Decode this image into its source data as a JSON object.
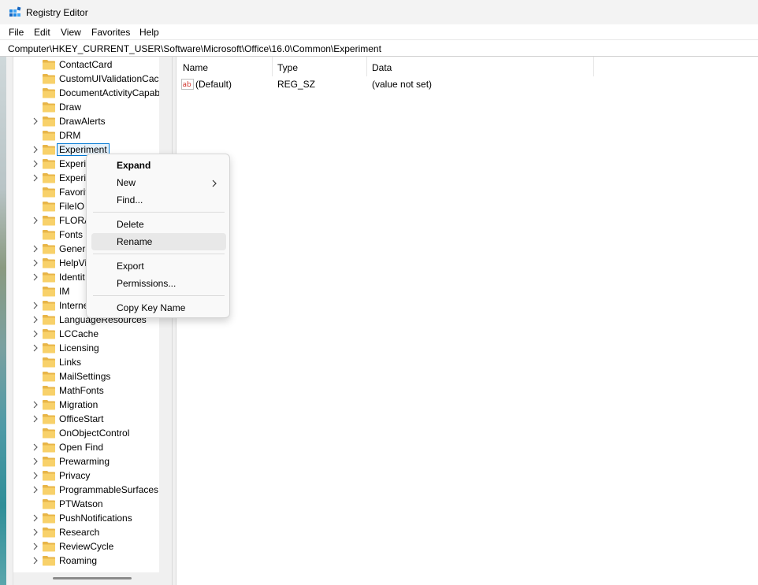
{
  "window": {
    "title": "Registry Editor",
    "app_icon": "registry-editor-icon"
  },
  "menu": [
    "File",
    "Edit",
    "View",
    "Favorites",
    "Help"
  ],
  "address": "Computer\\HKEY_CURRENT_USER\\Software\\Microsoft\\Office\\16.0\\Common\\Experiment",
  "tree": {
    "selected": "Experiment",
    "items": [
      {
        "label": "ContactCard",
        "has_children": false
      },
      {
        "label": "CustomUIValidationCac",
        "has_children": false
      },
      {
        "label": "DocumentActivityCapab",
        "has_children": false
      },
      {
        "label": "Draw",
        "has_children": false
      },
      {
        "label": "DrawAlerts",
        "has_children": true
      },
      {
        "label": "DRM",
        "has_children": false
      },
      {
        "label": "Experiment",
        "has_children": true
      },
      {
        "label": "Experin",
        "has_children": true
      },
      {
        "label": "Experin",
        "has_children": true
      },
      {
        "label": "Favorit",
        "has_children": false
      },
      {
        "label": "FileIO",
        "has_children": false
      },
      {
        "label": "FLORA",
        "has_children": true
      },
      {
        "label": "Fonts",
        "has_children": false
      },
      {
        "label": "Genera",
        "has_children": true
      },
      {
        "label": "HelpVi",
        "has_children": true
      },
      {
        "label": "Identit",
        "has_children": true
      },
      {
        "label": "IM",
        "has_children": false
      },
      {
        "label": "Interne",
        "has_children": true
      },
      {
        "label": "LanguageResources",
        "has_children": true
      },
      {
        "label": "LCCache",
        "has_children": true
      },
      {
        "label": "Licensing",
        "has_children": true
      },
      {
        "label": "Links",
        "has_children": false
      },
      {
        "label": "MailSettings",
        "has_children": false
      },
      {
        "label": "MathFonts",
        "has_children": false
      },
      {
        "label": "Migration",
        "has_children": true
      },
      {
        "label": "OfficeStart",
        "has_children": true
      },
      {
        "label": "OnObjectControl",
        "has_children": false
      },
      {
        "label": "Open Find",
        "has_children": true
      },
      {
        "label": "Prewarming",
        "has_children": true
      },
      {
        "label": "Privacy",
        "has_children": true
      },
      {
        "label": "ProgrammableSurfaces",
        "has_children": true
      },
      {
        "label": "PTWatson",
        "has_children": false
      },
      {
        "label": "PushNotifications",
        "has_children": true
      },
      {
        "label": "Research",
        "has_children": true
      },
      {
        "label": "ReviewCycle",
        "has_children": true
      },
      {
        "label": "Roaming",
        "has_children": true
      }
    ]
  },
  "list": {
    "columns": [
      "Name",
      "Type",
      "Data"
    ],
    "rows": [
      {
        "name": "(Default)",
        "type": "REG_SZ",
        "data": "(value not set)",
        "icon": "string-value-icon"
      }
    ]
  },
  "context_menu": {
    "items": [
      {
        "label": "Expand",
        "bold": true
      },
      {
        "label": "New",
        "submenu": true
      },
      {
        "label": "Find..."
      },
      {
        "label": "Delete"
      },
      {
        "label": "Rename",
        "hover": true
      },
      {
        "label": "Export"
      },
      {
        "label": "Permissions..."
      },
      {
        "label": "Copy Key Name"
      }
    ]
  },
  "colors": {
    "folder": "#f8d16a",
    "selection_outline": "#0078d4",
    "menu_hover": "#e8e8e8"
  }
}
